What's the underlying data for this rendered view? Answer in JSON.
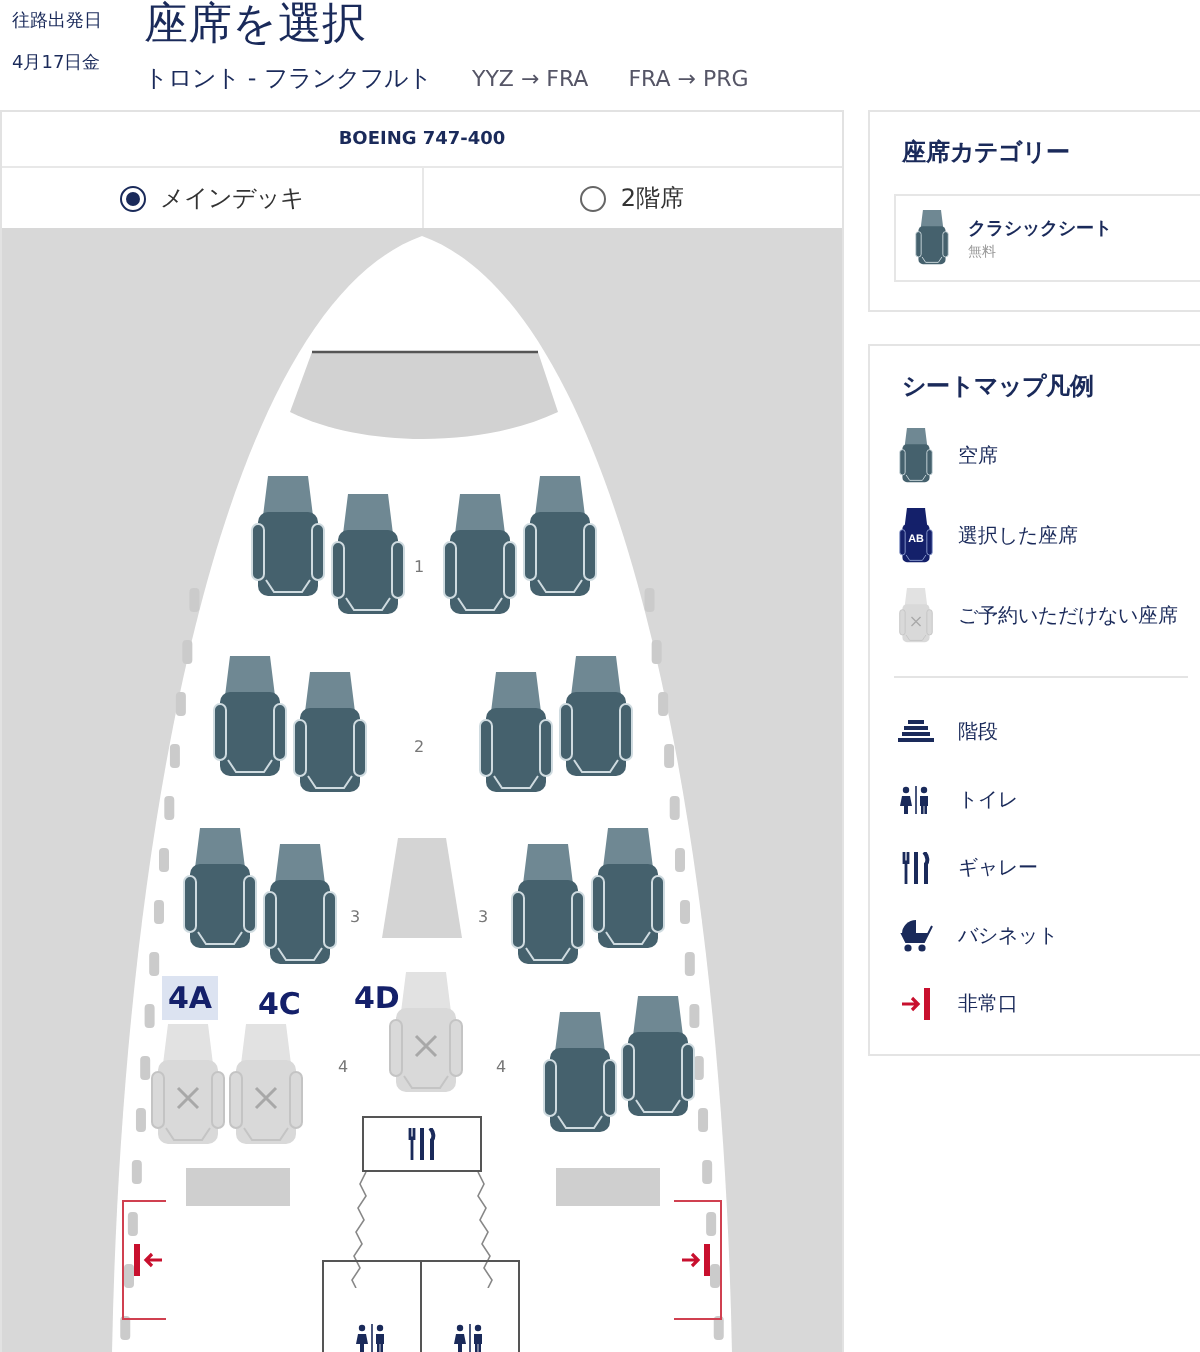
{
  "header": {
    "date_label": "往路出発日",
    "date": "4月17日金",
    "title": "座席を選択",
    "route": "トロント - フランクフルト",
    "segments": [
      "YYZ → FRA",
      "FRA → PRG"
    ]
  },
  "aircraft": "BOEING 747-400",
  "decks": [
    {
      "label": "メインデッキ",
      "selected": true
    },
    {
      "label": "2階席",
      "selected": false
    }
  ],
  "seat_map": {
    "rows": [
      {
        "numbers": [
          "1"
        ],
        "seats": [
          {
            "available": true
          },
          {
            "available": true
          },
          {
            "available": true
          },
          {
            "available": true
          }
        ]
      },
      {
        "numbers": [
          "2"
        ],
        "seats": [
          {
            "available": true
          },
          {
            "available": true
          },
          {
            "available": true
          },
          {
            "available": true
          }
        ]
      },
      {
        "numbers": [
          "3",
          "3"
        ],
        "seats": [
          {
            "available": true
          },
          {
            "available": true
          },
          {
            "available": true
          },
          {
            "available": true
          }
        ]
      },
      {
        "numbers": [
          "4",
          "4"
        ],
        "seats": [
          {
            "label": "4A",
            "available": false,
            "highlighted": true
          },
          {
            "label": "4C",
            "available": false,
            "highlighted": false
          },
          {
            "label": "4D",
            "available": false,
            "highlighted": false
          },
          {
            "available": true
          },
          {
            "available": true
          }
        ]
      }
    ]
  },
  "category": {
    "title": "座席カテゴリー",
    "items": [
      {
        "name": "クラシックシート",
        "price": "無料"
      }
    ]
  },
  "legend": {
    "title": "シートマップ凡例",
    "items": [
      {
        "kind": "available",
        "label": "空席"
      },
      {
        "kind": "selected",
        "label": "選択した座席",
        "icon_text": "AB"
      },
      {
        "kind": "unavailable",
        "label": "ご予約いただけない座席"
      },
      {
        "kind": "stairs",
        "label": "階段"
      },
      {
        "kind": "toilet",
        "label": "トイレ"
      },
      {
        "kind": "galley",
        "label": "ギャレー"
      },
      {
        "kind": "bassinet",
        "label": "バシネット"
      },
      {
        "kind": "exit",
        "label": "非常口"
      }
    ]
  }
}
